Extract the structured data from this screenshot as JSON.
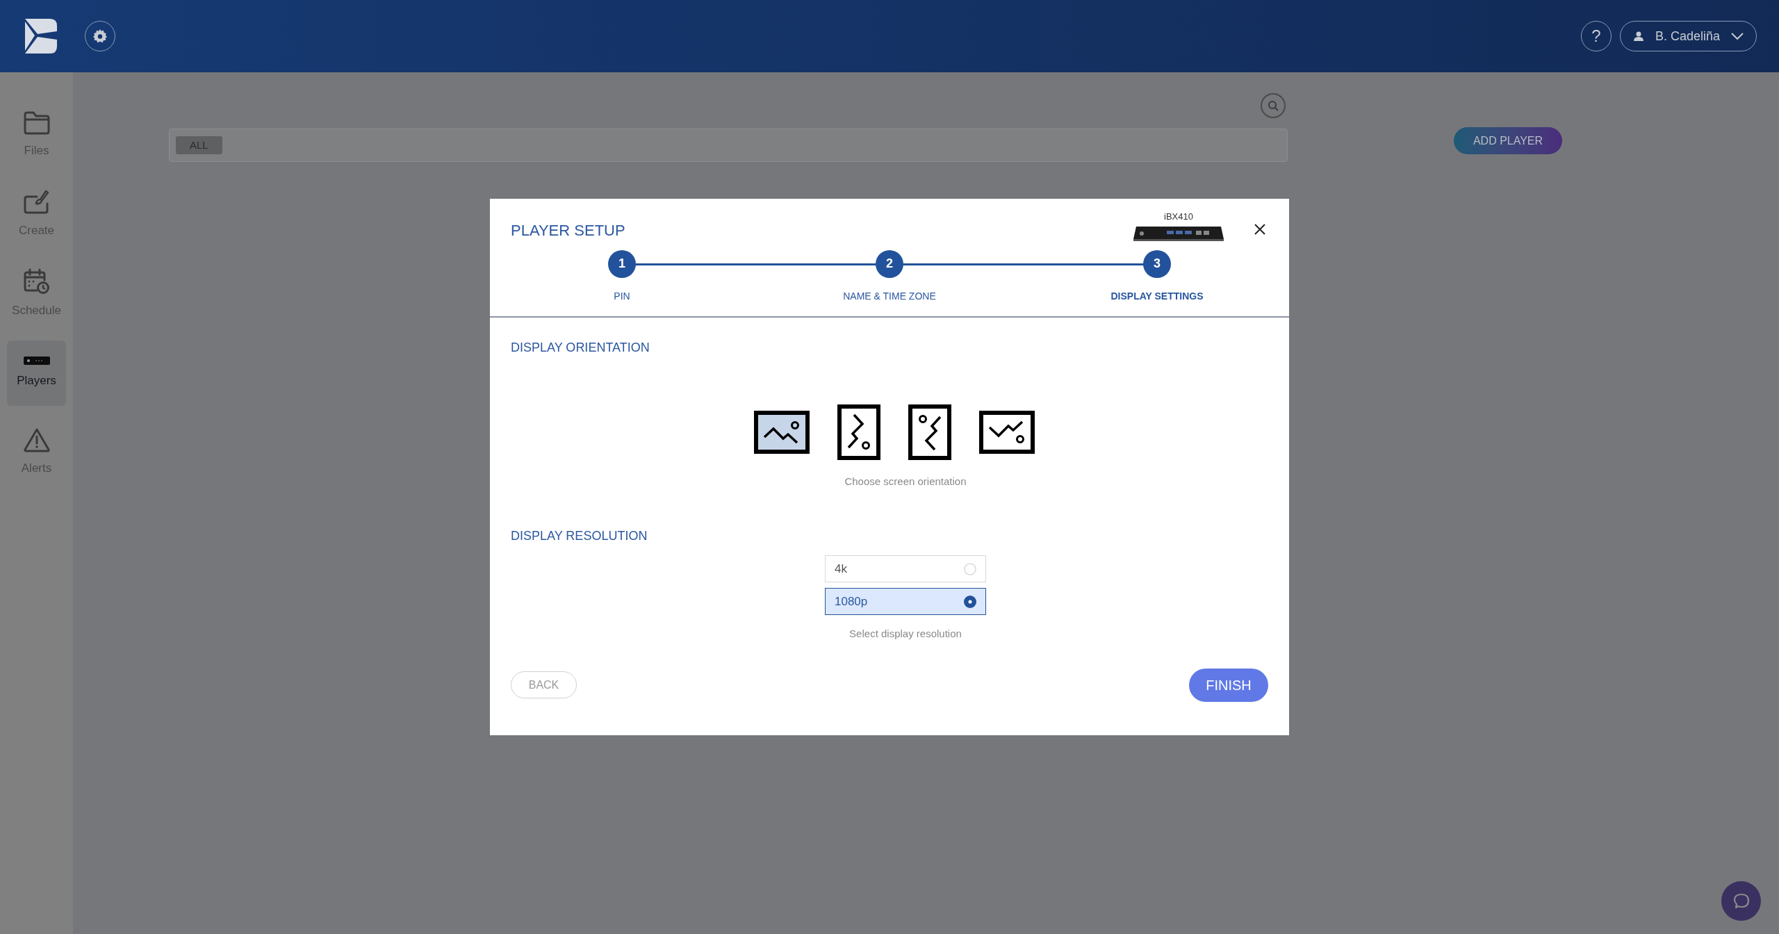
{
  "header": {
    "user": {
      "name": "B. Cadeliña"
    },
    "help": "?"
  },
  "sidebar": {
    "items": [
      {
        "kind": "files",
        "label": "Files",
        "selected": false
      },
      {
        "kind": "create",
        "label": "Create",
        "selected": false
      },
      {
        "kind": "schedule",
        "label": "Schedule",
        "selected": false
      },
      {
        "kind": "players",
        "label": "Players",
        "selected": true
      },
      {
        "kind": "alerts",
        "label": "Alerts",
        "selected": false
      }
    ]
  },
  "filter_bar": {
    "chip": "ALL"
  },
  "add_player_button": "ADD PLAYER",
  "dialog": {
    "title": "PLAYER SETUP",
    "device": {
      "model": "iBX410"
    },
    "steps": [
      {
        "number": "1",
        "label": "PIN",
        "selected": false
      },
      {
        "number": "2",
        "label": "NAME & TIME ZONE",
        "selected": false
      },
      {
        "number": "3",
        "label": "DISPLAY SETTINGS",
        "selected": true
      }
    ],
    "orientation": {
      "heading": "DISPLAY ORIENTATION",
      "options": [
        {
          "kind": "landscape",
          "selected": true
        },
        {
          "kind": "portrait",
          "selected": false
        },
        {
          "kind": "portrait_flipped",
          "selected": false
        },
        {
          "kind": "landscape_flipped",
          "selected": false
        }
      ],
      "hint": "Choose screen orientation"
    },
    "resolution": {
      "heading": "DISPLAY RESOLUTION",
      "options": [
        {
          "label": "4k",
          "selected": false
        },
        {
          "label": "1080p",
          "selected": true
        }
      ],
      "hint": "Select display resolution"
    },
    "back_button": "BACK",
    "finish_button": "FINISH"
  }
}
